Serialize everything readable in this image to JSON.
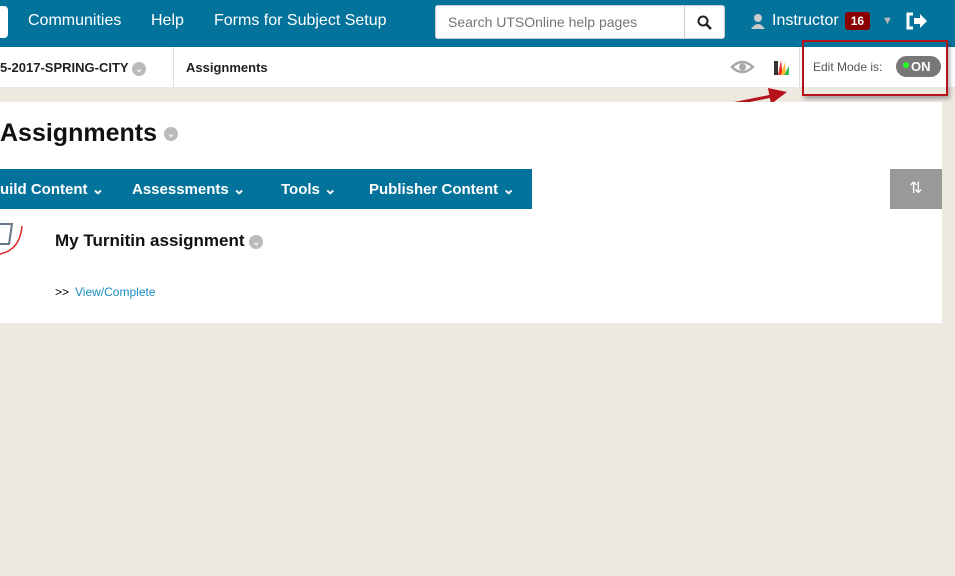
{
  "topnav": {
    "links": [
      "Communities",
      "Help",
      "Forms for Subject Setup"
    ],
    "search_placeholder": "Search UTSOnline help pages",
    "user": "Instructor",
    "notifications": "16"
  },
  "breadcrumb": {
    "course": "5-2017-SPRING-CITY",
    "page": "Assignments"
  },
  "edit_mode": {
    "label": "Edit Mode is:",
    "state": "ON"
  },
  "page": {
    "title": "Assignments",
    "menu": [
      "uild Content",
      "Assessments",
      "Tools",
      "Publisher Content"
    ]
  },
  "item": {
    "title": "My Turnitin assignment",
    "prefix": ">>",
    "link": "View/Complete"
  }
}
